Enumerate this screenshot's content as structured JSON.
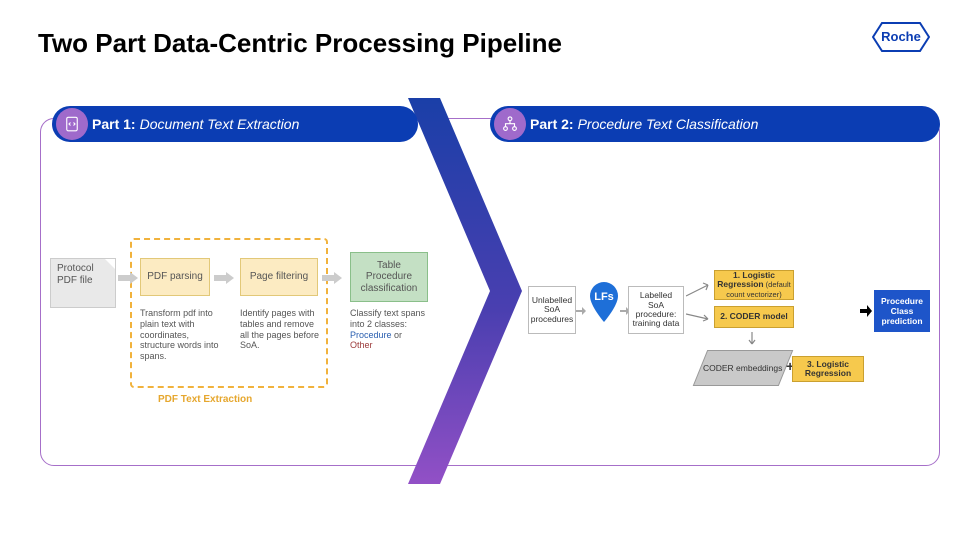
{
  "title": "Two Part Data-Centric Processing Pipeline",
  "logo_text": "Roche",
  "parts": [
    {
      "label_bold": "Part 1:",
      "label_italic": "Document Text Extraction"
    },
    {
      "label_bold": "Part 2:",
      "label_italic": "Procedure Text Classification"
    }
  ],
  "part1": {
    "protocol": "Protocol PDF file",
    "pdf_parsing": "PDF parsing",
    "page_filtering": "Page filtering",
    "table_proc": "Table Procedure classification",
    "desc_pdf": "Transform pdf into plain text with coordinates, structure words into spans.",
    "desc_page": "Identify pages with tables and remove all the pages before SoA.",
    "desc_table_pre": "Classify text spans into 2 classes:",
    "desc_table_proc": "Procedure",
    "desc_table_or": " or ",
    "desc_table_other": "Other",
    "dashed_label": "PDF Text Extraction"
  },
  "part2": {
    "unlabelled": "Unlabelled SoA procedures",
    "lfs": "LFs",
    "labelled": "Labelled SoA procedure: training data",
    "reg1_strong": "1. Logistic Regression",
    "reg1_paren": " (default count vectorizer)",
    "coder": "2. CODER model",
    "embeddings": "CODER embeddings",
    "plus": "+",
    "reg2": "3. Logistic Regression",
    "output": "Procedure Class prediction"
  }
}
